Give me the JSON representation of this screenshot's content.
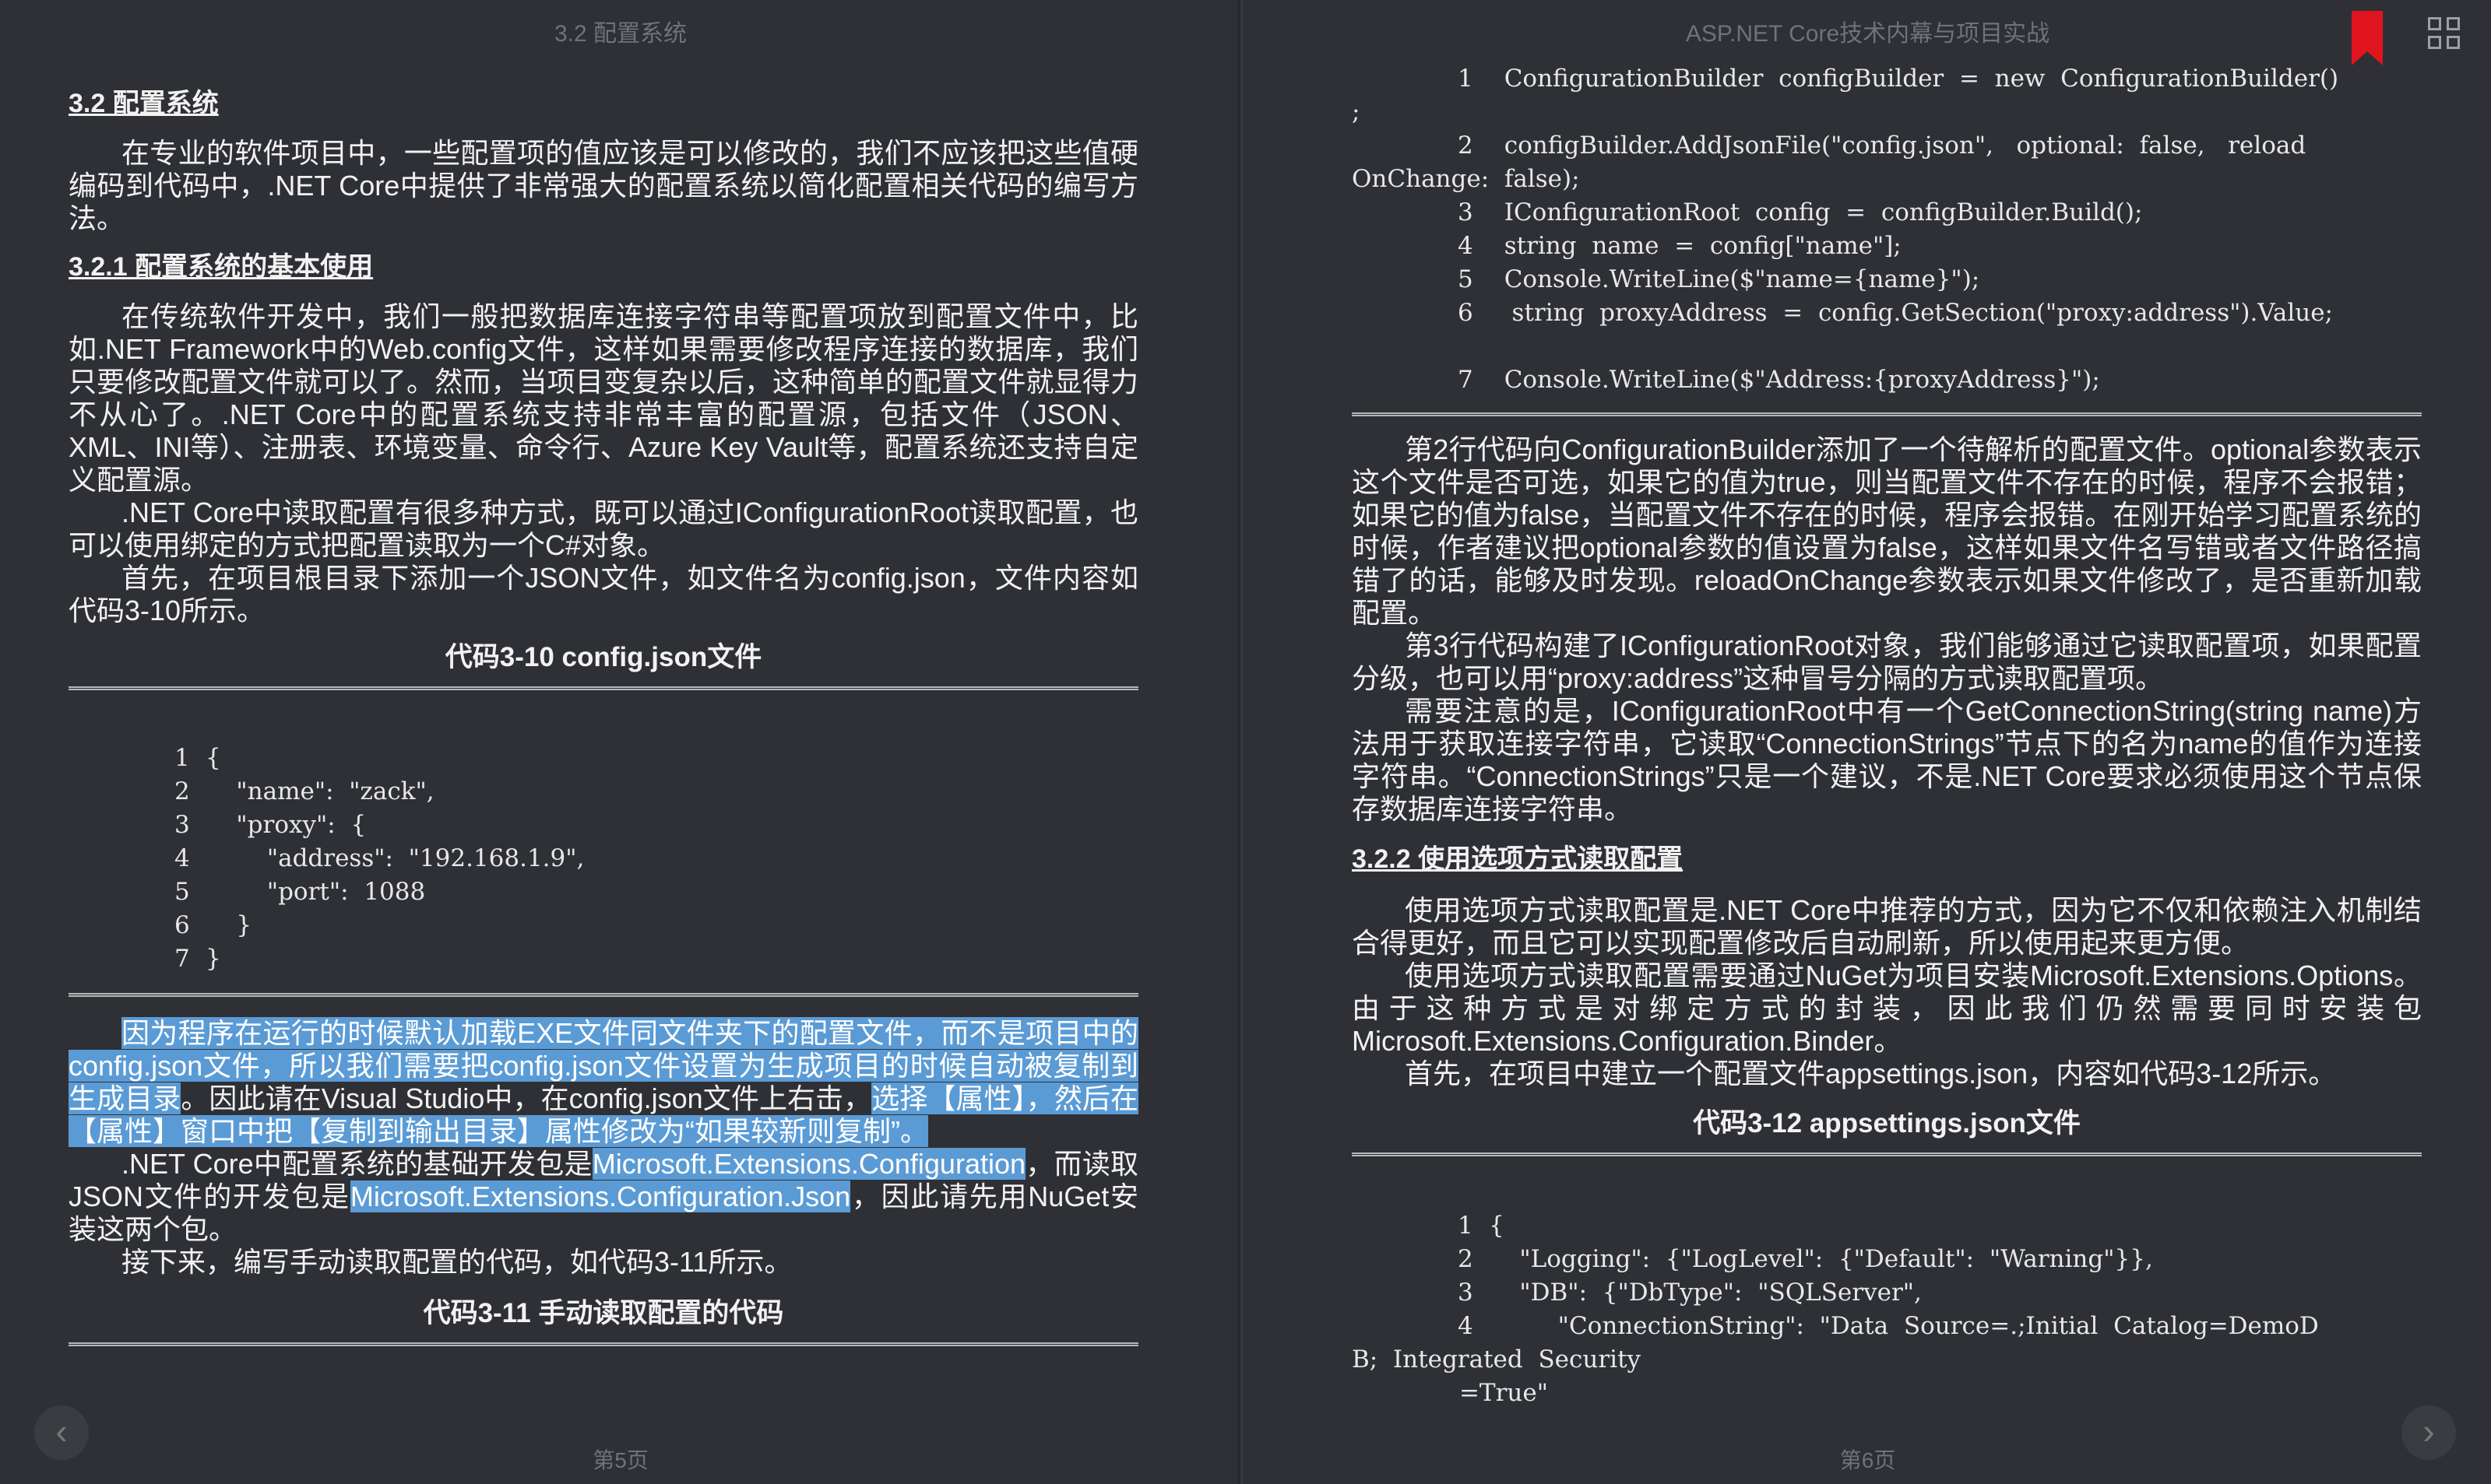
{
  "left": {
    "running_head": "3.2 配置系统",
    "page_number": "第5页",
    "h_3_2": "3.2 配置系统",
    "p1": "在专业的软件项目中，一些配置项的值应该是可以修改的，我们不应该把这些值硬编码到代码中，.NET Core中提供了非常强大的配置系统以简化配置相关代码的编写方法。",
    "h_3_2_1": "3.2.1 配置系统的基本使用",
    "p2": "在传统软件开发中，我们一般把数据库连接字符串等配置项放到配置文件中，比如.NET Framework中的Web.config文件，这样如果需要修改程序连接的数据库，我们只要修改配置文件就可以了。然而，当项目变复杂以后，这种简单的配置文件就显得力不从心了。.NET Core中的配置系统支持非常丰富的配置源，包括文件（JSON、XML、INI等）、注册表、环境变量、命令行、Azure Key Vault等，配置系统还支持自定义配置源。",
    "p3": ".NET Core中读取配置有很多种方式，既可以通过IConfigurationRoot读取配置，也可以使用绑定的方式把配置读取为一个C#对象。",
    "p4": "首先，在项目根目录下添加一个JSON文件，如文件名为config.json，文件内容如代码3-10所示。",
    "caption_3_10": "代码3-10 config.json文件",
    "code_3_10": [
      {
        "n": "1",
        "t": "{"
      },
      {
        "n": "2",
        "t": "    \"name\":  \"zack\","
      },
      {
        "n": "3",
        "t": "    \"proxy\":  {"
      },
      {
        "n": "4",
        "t": "        \"address\":  \"192.168.1.9\","
      },
      {
        "n": "5",
        "t": "        \"port\":  1088"
      },
      {
        "n": "6",
        "t": "    }"
      },
      {
        "n": "7",
        "t": "}"
      }
    ],
    "p5_hl_a": "因为程序在运行的时候默认加载EXE文件同文件夹下的配置文件，而不是项目中的config.json文件，所以我们需要把config.json文件设置为生成项目的时候自动被复制到生成目录",
    "p5_plain": "。因此请在Visual Studio中，在config.json文件上右击，",
    "p5_hl_b": "选择【属性】，然后在【属性】窗口中把【复制到输出目录】属性修改为“如果较新则复制”。",
    "p6_a": ".NET Core中配置系统的基础开发包是",
    "p6_hl_a": "Microsoft.Extensions.Configuration",
    "p6_b": "，而读取JSON文件的开发包是",
    "p6_hl_b": "Microsoft.Extensions.Configuration.Json",
    "p6_c": "，因此请先用NuGet安装这两个包。",
    "p7": "接下来，编写手动读取配置的代码，如代码3-11所示。",
    "caption_3_11": "代码3-11 手动读取配置的代码"
  },
  "right": {
    "running_head": "ASP.NET Core技术内幕与项目实战",
    "page_number": "第6页",
    "code_3_11": [
      {
        "n": "1",
        "t": "  ConfigurationBuilder  configBuilder  =  new  ConfigurationBuilder()"
      },
      {
        "n": "",
        "t": ";"
      },
      {
        "n": "2",
        "t": "  configBuilder.AddJsonFile(\"config.json\",   optional:  false,   reload"
      },
      {
        "n": "",
        "t": "OnChange:  false);"
      },
      {
        "n": "3",
        "t": "  IConfigurationRoot  config  =  configBuilder.Build();"
      },
      {
        "n": "4",
        "t": "  string  name  =  config[\"name\"];"
      },
      {
        "n": "5",
        "t": "  Console.WriteLine($\"name={name}\");"
      },
      {
        "n": "6",
        "t": "   string  proxyAddress  =  config.GetSection(\"proxy:address\").Value;"
      },
      {
        "n": "",
        "t": ""
      },
      {
        "n": "7",
        "t": "  Console.WriteLine($\"Address:{proxyAddress}\");"
      }
    ],
    "p1": "第2行代码向ConfigurationBuilder添加了一个待解析的配置文件。optional参数表示这个文件是否可选，如果它的值为true，则当配置文件不存在的时候，程序不会报错；如果它的值为false，当配置文件不存在的时候，程序会报错。在刚开始学习配置系统的时候，作者建议把optional参数的值设置为false，这样如果文件名写错或者文件路径搞错了的话，能够及时发现。reloadOnChange参数表示如果文件修改了，是否重新加载配置。",
    "p2": "第3行代码构建了IConfigurationRoot对象，我们能够通过它读取配置项，如果配置分级，也可以用“proxy:address”这种冒号分隔的方式读取配置项。",
    "p3": "需要注意的是，IConfigurationRoot中有一个GetConnectionString(string name)方法用于获取连接字符串，它读取“ConnectionStrings”节点下的名为name的值作为连接字符串。“ConnectionStrings”只是一个建议，不是.NET Core要求必须使用这个节点保存数据库连接字符串。",
    "h_3_2_2": "3.2.2 使用选项方式读取配置",
    "p4": "使用选项方式读取配置是.NET Core中推荐的方式，因为它不仅和依赖注入机制结合得更好，而且它可以实现配置修改后自动刷新，所以使用起来更方便。",
    "p5": "使用选项方式读取配置需要通过NuGet为项目安装Microsoft.Extensions.Options。由于这种方式是对绑定方式的封装，因此我们仍然需要同时安装包Microsoft.Extensions.Configuration.Binder。",
    "p6": "首先，在项目中建立一个配置文件appsettings.json，内容如代码3-12所示。",
    "caption_3_12": "代码3-12 appsettings.json文件",
    "code_3_12": [
      {
        "n": "1",
        "t": "{"
      },
      {
        "n": "2",
        "t": "    \"Logging\":  {\"LogLevel\":  {\"Default\":  \"Warning\"}},"
      },
      {
        "n": "3",
        "t": "    \"DB\":  {\"DbType\":  \"SQLServer\","
      },
      {
        "n": "4",
        "t": "         \"ConnectionString\":  \"Data  Source=.;Initial  Catalog=DemoD"
      },
      {
        "n": "",
        "t": "B;  Integrated  Security"
      },
      {
        "n": "",
        "t": "              =True\""
      }
    ]
  },
  "nav": {
    "prev": "‹",
    "next": "›"
  },
  "colors": {
    "background": "#2e3035",
    "highlight": "#5b9bd5",
    "bookmark": "#e0141e"
  },
  "icons": {
    "bookmark": "bookmark-icon",
    "grid": "grid-view-icon",
    "prev": "chevron-left-icon",
    "next": "chevron-right-icon"
  }
}
